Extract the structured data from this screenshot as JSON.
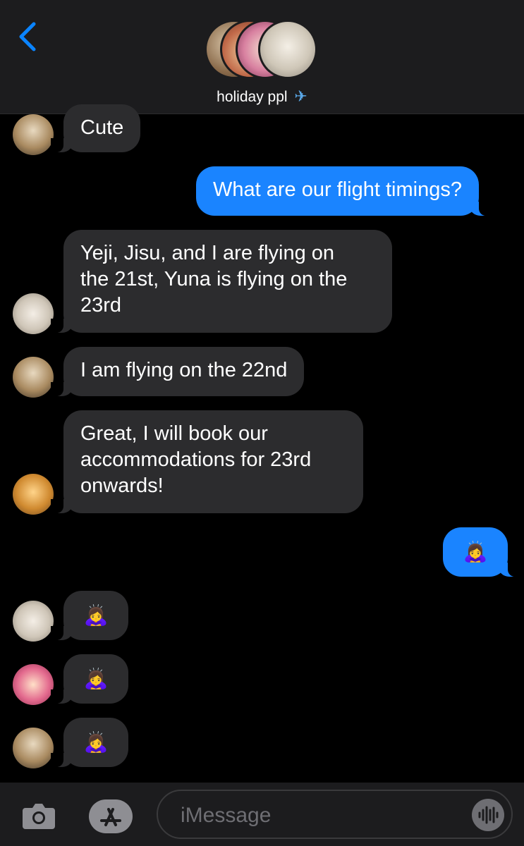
{
  "header": {
    "title": "holiday ppl",
    "title_icon": "airplane-icon"
  },
  "messages": [
    {
      "id": "m1",
      "direction": "incoming",
      "text": "Cute"
    },
    {
      "id": "m2",
      "direction": "outgoing",
      "text": "What are our flight timings?"
    },
    {
      "id": "m3",
      "direction": "incoming",
      "text": "Yeji, Jisu, and I are flying on\nthe 21st, Yuna is flying on the\n23rd"
    },
    {
      "id": "m4",
      "direction": "incoming",
      "text": "I am flying on the 22nd"
    },
    {
      "id": "m5",
      "direction": "incoming",
      "text": "Great, I will book our\naccommodations for 23rd\nonwards!"
    },
    {
      "id": "m6",
      "direction": "outgoing",
      "emoji": "🙇‍♀️"
    },
    {
      "id": "m7",
      "direction": "incoming",
      "emoji": "🙇‍♀️"
    },
    {
      "id": "m8",
      "direction": "incoming",
      "emoji": "🙇‍♀️"
    },
    {
      "id": "m9",
      "direction": "incoming",
      "emoji": "🙇‍♀️"
    }
  ],
  "input": {
    "placeholder": "iMessage"
  },
  "colors": {
    "outgoing_bubble": "#1a84ff",
    "incoming_bubble": "#2c2c2e",
    "accent": "#0a84ff"
  }
}
